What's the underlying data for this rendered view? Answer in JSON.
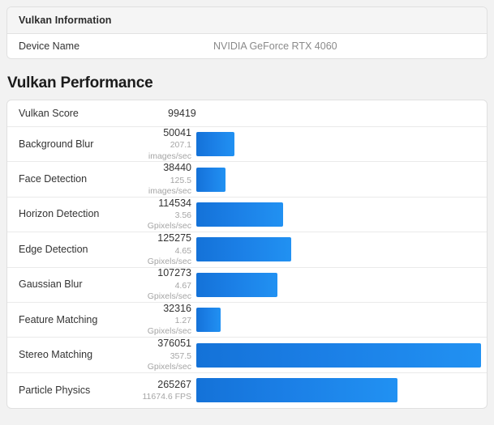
{
  "info_panel": {
    "header_title": "Vulkan Information",
    "rows": [
      {
        "label": "Device Name",
        "value": "NVIDIA GeForce RTX 4060"
      }
    ]
  },
  "section": {
    "title": "Vulkan Performance"
  },
  "score_row": {
    "label": "Vulkan Score",
    "value": "99419"
  },
  "colors": {
    "bar_start": "#1472d8",
    "bar_end": "#2191f2",
    "panel_header_bg": "#f5f5f5",
    "page_bg": "#f2f2f2",
    "muted_text": "#a5a5a5"
  },
  "chart_data": {
    "type": "bar",
    "title": "Vulkan Performance",
    "xlabel": "",
    "ylabel": "",
    "orientation": "horizontal",
    "grid": false,
    "legend": null,
    "max_value": 376051,
    "categories": [
      "Background Blur",
      "Face Detection",
      "Horizon Detection",
      "Edge Detection",
      "Gaussian Blur",
      "Feature Matching",
      "Stereo Matching",
      "Particle Physics"
    ],
    "values": [
      50041,
      38440,
      114534,
      125275,
      107273,
      32316,
      376051,
      265267
    ],
    "rates": [
      "207.1 images/sec",
      "125.5 images/sec",
      "3.56 Gpixels/sec",
      "4.65 Gpixels/sec",
      "4.67 Gpixels/sec",
      "1.27 Gpixels/sec",
      "357.5 Gpixels/sec",
      "11674.6 FPS"
    ],
    "rows": [
      {
        "name": "Background Blur",
        "score": "50041",
        "rate": "207.1 images/sec",
        "value": 50041
      },
      {
        "name": "Face Detection",
        "score": "38440",
        "rate": "125.5 images/sec",
        "value": 38440
      },
      {
        "name": "Horizon Detection",
        "score": "114534",
        "rate": "3.56 Gpixels/sec",
        "value": 114534
      },
      {
        "name": "Edge Detection",
        "score": "125275",
        "rate": "4.65 Gpixels/sec",
        "value": 125275
      },
      {
        "name": "Gaussian Blur",
        "score": "107273",
        "rate": "4.67 Gpixels/sec",
        "value": 107273
      },
      {
        "name": "Feature Matching",
        "score": "32316",
        "rate": "1.27 Gpixels/sec",
        "value": 32316
      },
      {
        "name": "Stereo Matching",
        "score": "376051",
        "rate": "357.5 Gpixels/sec",
        "value": 376051
      },
      {
        "name": "Particle Physics",
        "score": "265267",
        "rate": "11674.6 FPS",
        "value": 265267
      }
    ]
  }
}
